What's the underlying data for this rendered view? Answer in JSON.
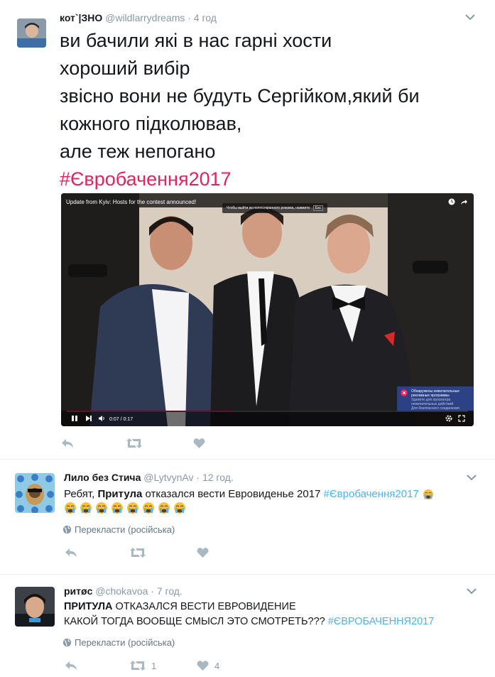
{
  "tweets": [
    {
      "name": "кот`|ЗНО",
      "handle": "@wildlarrydreams",
      "time": "· 4 год",
      "lines": [
        "ви бачили які в нас гарні хости",
        "хороший вибір",
        "звісно вони не будуть Сергійком,який би",
        "кожного підколював,",
        "але теж непогано"
      ],
      "hashtag": "#Євробачення2017",
      "video": {
        "title": "Update from Kyiv: Hosts for the contest announced!",
        "tooltip": "Чтобы выйти из полноэкранного режима, нажмите",
        "tooltip_key": "Esc",
        "time": "0:07 / 0:17",
        "progress": 0.41,
        "ad_title": "Обнаружены нежелательные рекламные программы",
        "ad_text": "Удалите для просмотра нежелательных действий",
        "ad_text2": "Для безопасного соединения"
      },
      "retweet_count": "",
      "like_count": ""
    },
    {
      "name": "Лило без Стича",
      "handle": "@LytvynAv",
      "time": "· 12 год.",
      "text_before": "Ребят, ",
      "text_bold": "Притула",
      "text_after": " отказался вести Евровиденье 2017 ",
      "hashtag": "#Євробачення2017",
      "emoji_count": 8,
      "translate": "Перекласти (російська)",
      "retweet_count": "",
      "like_count": ""
    },
    {
      "name": "ритøс",
      "handle": "@chokavoa",
      "time": "· 7 год.",
      "line1_bold": "ПРИТУЛА",
      "line1_rest": " ОТКАЗАЛСЯ ВЕСТИ ЕВРОВИДЕНИЕ",
      "line2": "КАКОЙ ТОГДА ВООБЩЕ СМЫСЛ ЭТО СМОТРЕТЬ??? ",
      "hashtag": "#ЄВРОБАЧЕННЯ2017",
      "translate": "Перекласти (російська)",
      "retweet_count": "1",
      "like_count": "4"
    }
  ],
  "colors": {
    "hashtag_pink": "#e0245e",
    "hashtag_blue": "#4ab3f4",
    "muted": "#8899a6",
    "icon": "#aab8c2"
  }
}
